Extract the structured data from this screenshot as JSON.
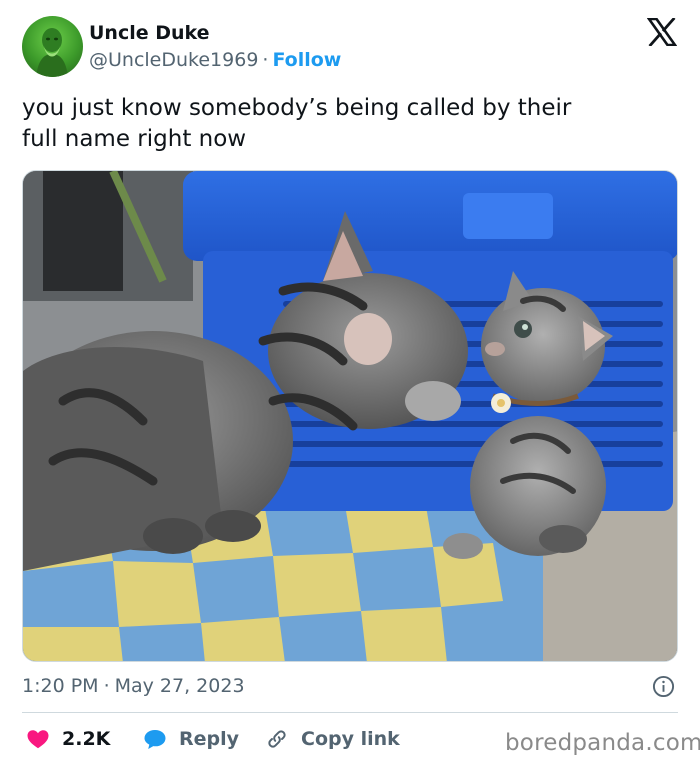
{
  "author": {
    "name": "Uncle Duke",
    "handle": "@UncleDuke1969",
    "separator": "·",
    "follow_label": "Follow"
  },
  "tweet": {
    "text_line1": "you just know somebody’s being called by their",
    "text_line2": "full name right now"
  },
  "meta": {
    "time": "1:20 PM",
    "separator": "·",
    "date": "May 27, 2023"
  },
  "actions": {
    "like_count": "2.2K",
    "reply_label": "Reply",
    "copy_label": "Copy link"
  },
  "watermark": "boredpanda.com",
  "media": {
    "alt": "An adult tabby cat sniffing a small tabby kitten in front of a blue plastic basket on a yellow and blue checkered floor"
  },
  "colors": {
    "accent": "#1d9bf0",
    "like": "#f91880",
    "text_primary": "#0f1419",
    "text_secondary": "#536471",
    "border": "#cfd9de"
  },
  "icons": {
    "brand": "x-logo-icon",
    "info": "info-icon",
    "like": "heart-icon",
    "reply": "speech-bubble-icon",
    "copy": "link-icon"
  }
}
